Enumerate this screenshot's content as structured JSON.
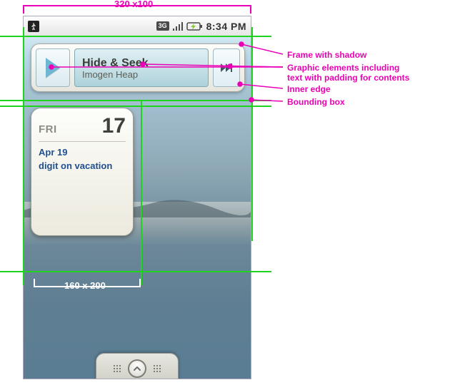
{
  "dimensions": {
    "top_label": "320 x100",
    "bottom_label": "160 x 200"
  },
  "status": {
    "network_label": "3G",
    "time": "8:34 PM"
  },
  "music": {
    "title": "Hide & Seek",
    "artist": "Imogen Heap"
  },
  "calendar": {
    "day_abbr": "FRI",
    "day_num": "17",
    "line1": "Apr 19",
    "line2": "digit on vacation"
  },
  "annotations": {
    "frame": "Frame with shadow",
    "graphics": "Graphic elements including",
    "graphics2": "text with padding for contents",
    "inner": "Inner edge",
    "bounding": "Bounding box"
  },
  "colors": {
    "guide": "#1fd41f",
    "anno": "#ec00b7"
  }
}
